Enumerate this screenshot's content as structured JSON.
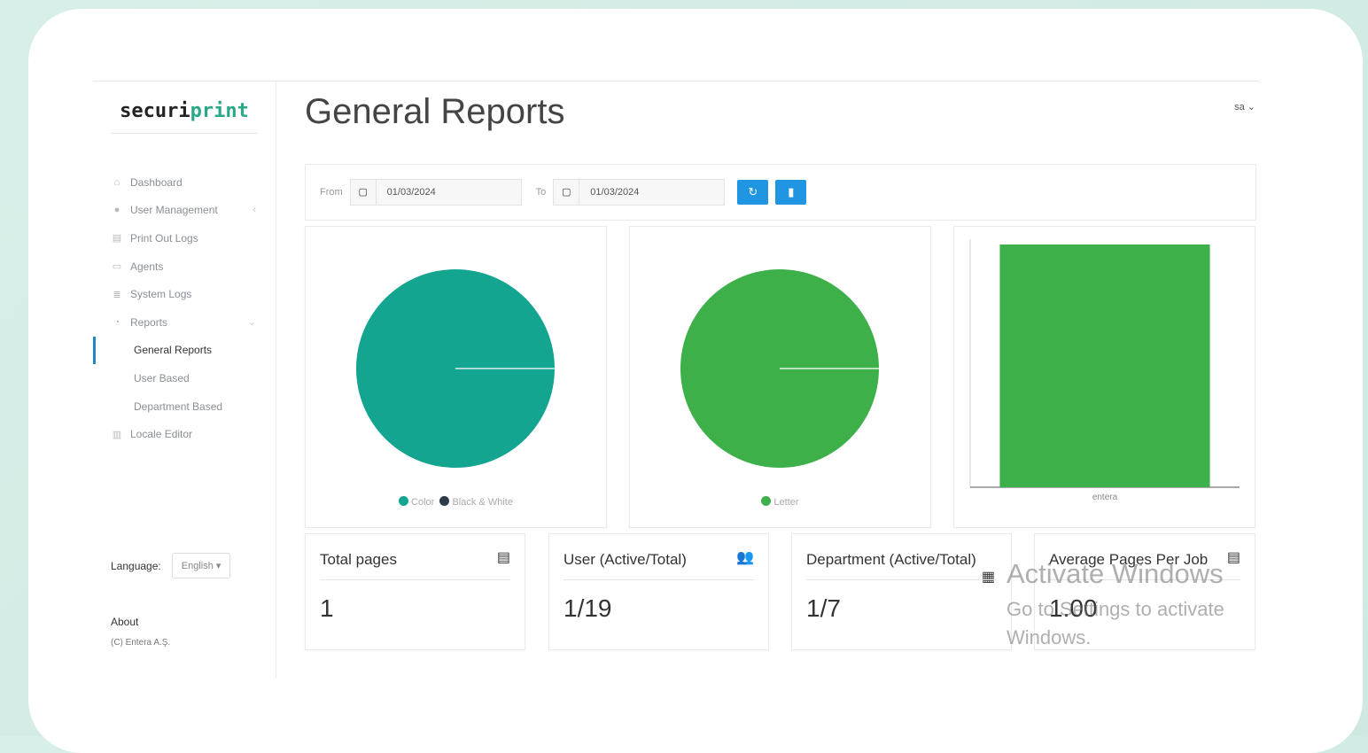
{
  "app": {
    "logo_part1": "securi",
    "logo_part2": "print"
  },
  "sidebar": {
    "items": [
      {
        "icon": "home-icon",
        "label": "Dashboard"
      },
      {
        "icon": "user-icon",
        "label": "User Management"
      },
      {
        "icon": "printer-icon",
        "label": "Print Out Logs"
      },
      {
        "icon": "monitor-icon",
        "label": "Agents"
      },
      {
        "icon": "database-icon",
        "label": "System Logs"
      },
      {
        "icon": "pie-chart-icon",
        "label": "Reports"
      }
    ],
    "sub_items": [
      "General Reports",
      "User Based",
      "Department Based"
    ],
    "locale_editor": "Locale Editor",
    "language_label": "Language:",
    "language_value": "English",
    "about": "About",
    "copyright": "(C) Entera A.Ş."
  },
  "header": {
    "title": "General Reports",
    "user": "sa"
  },
  "filter": {
    "from_label": "From",
    "from_value": "01/03/2024",
    "to_label": "To",
    "to_value": "01/03/2024"
  },
  "chart_data": [
    {
      "type": "pie",
      "labels": [
        "Color",
        "Black & White"
      ],
      "values": [
        1,
        0
      ],
      "colors": [
        "#13a58f",
        "#2e3a48"
      ]
    },
    {
      "type": "pie",
      "labels": [
        "Letter"
      ],
      "values": [
        1
      ],
      "colors": [
        "#3db04a"
      ]
    },
    {
      "type": "bar",
      "categories": [
        "entera"
      ],
      "values": [
        1
      ],
      "ylim": [
        0,
        1
      ],
      "colors": [
        "#3db04a"
      ]
    }
  ],
  "stats": [
    {
      "title": "Total pages",
      "value": "1",
      "icon": "fax-icon"
    },
    {
      "title": "User (Active/Total)",
      "value": "1/19",
      "icon": "users-icon"
    },
    {
      "title": "Department (Active/Total)",
      "value": "1/7",
      "icon": "building-icon"
    },
    {
      "title": "Average Pages Per Job",
      "value": "1.00",
      "icon": "fax-icon"
    }
  ],
  "watermark": {
    "line1": "Activate Windows",
    "line2": "Go to Settings to activate Windows."
  }
}
